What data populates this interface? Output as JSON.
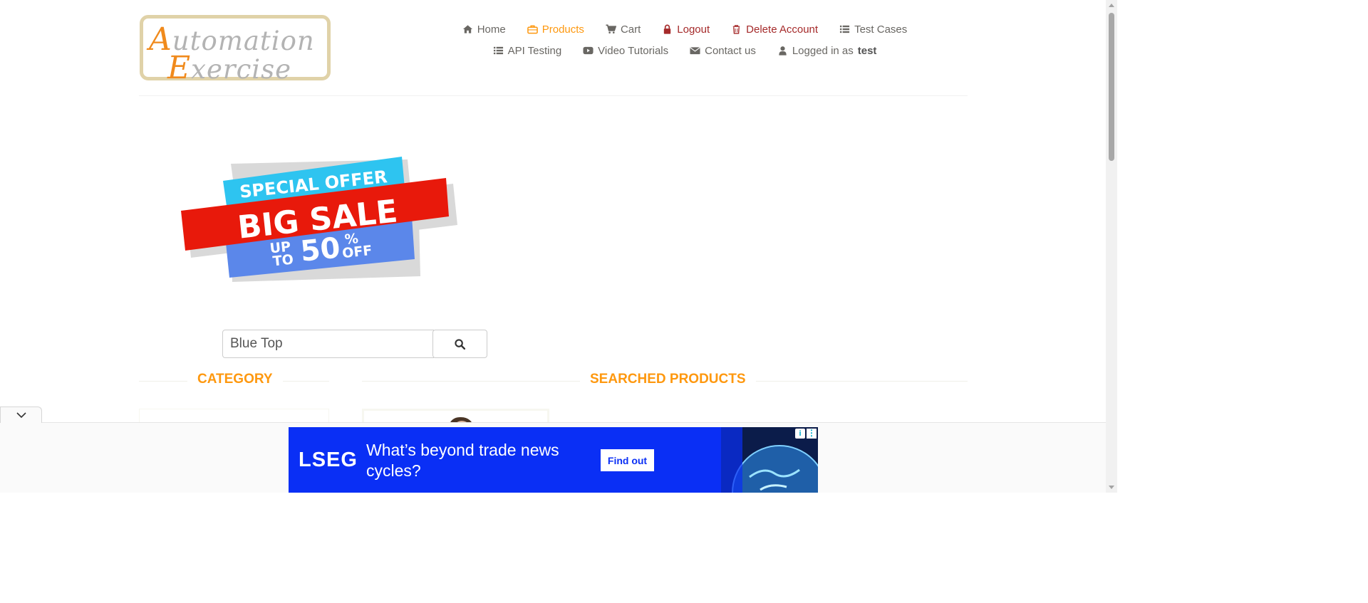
{
  "logo": {
    "line1_first": "A",
    "line1_rest": "utomation",
    "line2_first": "E",
    "line2_rest": "xercise"
  },
  "nav": {
    "home": "Home",
    "products": "Products",
    "cart": "Cart",
    "logout": "Logout",
    "delete_account": "Delete Account",
    "test_cases": "Test Cases",
    "api_testing": "API Testing",
    "video_tutorials": "Video Tutorials",
    "contact_us": "Contact us",
    "logged_in_prefix": "Logged in as",
    "username": "test"
  },
  "banner": {
    "special_offer": "SPECIAL OFFER",
    "big_sale": "BIG SALE",
    "up": "UP",
    "to": "TO",
    "percent_value": "50",
    "percent_sign": "%",
    "off": "OFF"
  },
  "search": {
    "value": "Blue Top",
    "icon": "search-icon"
  },
  "sections": {
    "category": "CATEGORY",
    "searched_products": "SEARCHED PRODUCTS"
  },
  "ad": {
    "brand": "LSEG",
    "headline": "What’s beyond trade news cycles?",
    "cta": "Find out",
    "info": "i",
    "menu": "⋮"
  },
  "colors": {
    "accent": "#fe980f",
    "danger": "#a52a2a",
    "ad_blue": "#0a2ff5",
    "text": "#696763"
  }
}
